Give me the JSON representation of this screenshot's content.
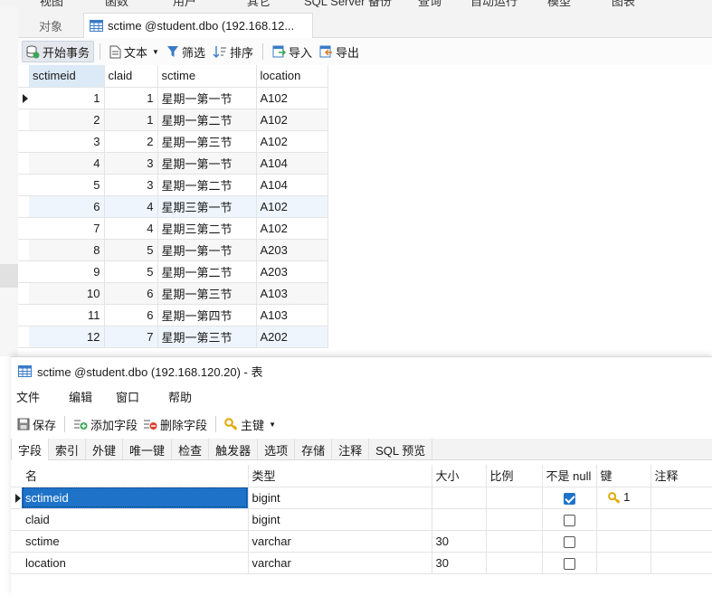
{
  "top_menu": [
    "视图",
    "函数",
    "用户",
    "其它",
    "SQL Server 备份",
    "查询",
    "自动运行",
    "模型",
    "图表"
  ],
  "tabs": [
    {
      "label": "对象",
      "active": false
    },
    {
      "label": "sctime @student.dbo (192.168.12...",
      "active": true
    }
  ],
  "toolbar": {
    "begin_transaction": "开始事务",
    "text": "文本",
    "filter": "筛选",
    "sort": "排序",
    "import": "导入",
    "export": "导出"
  },
  "grid": {
    "columns": [
      "sctimeid",
      "claid",
      "sctime",
      "location"
    ],
    "rows": [
      {
        "sctimeid": "1",
        "claid": "1",
        "sctime": "星期一第一节",
        "location": "A102"
      },
      {
        "sctimeid": "2",
        "claid": "1",
        "sctime": "星期一第二节",
        "location": "A102"
      },
      {
        "sctimeid": "3",
        "claid": "2",
        "sctime": "星期一第三节",
        "location": "A102"
      },
      {
        "sctimeid": "4",
        "claid": "3",
        "sctime": "星期一第一节",
        "location": "A104"
      },
      {
        "sctimeid": "5",
        "claid": "3",
        "sctime": "星期一第二节",
        "location": "A104"
      },
      {
        "sctimeid": "6",
        "claid": "4",
        "sctime": "星期三第一节",
        "location": "A102"
      },
      {
        "sctimeid": "7",
        "claid": "4",
        "sctime": "星期三第二节",
        "location": "A102"
      },
      {
        "sctimeid": "8",
        "claid": "5",
        "sctime": "星期一第一节",
        "location": "A203"
      },
      {
        "sctimeid": "9",
        "claid": "5",
        "sctime": "星期一第二节",
        "location": "A203"
      },
      {
        "sctimeid": "10",
        "claid": "6",
        "sctime": "星期一第三节",
        "location": "A103"
      },
      {
        "sctimeid": "11",
        "claid": "6",
        "sctime": "星期一第四节",
        "location": "A103"
      },
      {
        "sctimeid": "12",
        "claid": "7",
        "sctime": "星期一第三节",
        "location": "A202"
      }
    ]
  },
  "designer": {
    "title": "sctime @student.dbo (192.168.120.20) - 表",
    "menu": [
      "文件",
      "编辑",
      "窗口",
      "帮助"
    ],
    "toolbar": {
      "save": "保存",
      "add_field": "添加字段",
      "delete_field": "删除字段",
      "primary_key": "主键"
    },
    "tabs": [
      "字段",
      "索引",
      "外键",
      "唯一键",
      "检查",
      "触发器",
      "选项",
      "存储",
      "注释",
      "SQL 预览"
    ],
    "field_columns": [
      "名",
      "类型",
      "大小",
      "比例",
      "不是 null",
      "键",
      "注释"
    ],
    "fields": [
      {
        "name": "sctimeid",
        "type": "bigint",
        "size": "",
        "scale": "",
        "not_null": true,
        "key": "1",
        "comment": ""
      },
      {
        "name": "claid",
        "type": "bigint",
        "size": "",
        "scale": "",
        "not_null": false,
        "key": "",
        "comment": ""
      },
      {
        "name": "sctime",
        "type": "varchar",
        "size": "30",
        "scale": "",
        "not_null": false,
        "key": "",
        "comment": ""
      },
      {
        "name": "location",
        "type": "varchar",
        "size": "30",
        "scale": "",
        "not_null": false,
        "key": "",
        "comment": ""
      }
    ]
  },
  "colors": {
    "selection": "#1e73c8",
    "header_sorted": "#dceaf7",
    "key_icon": "#e0a800"
  }
}
